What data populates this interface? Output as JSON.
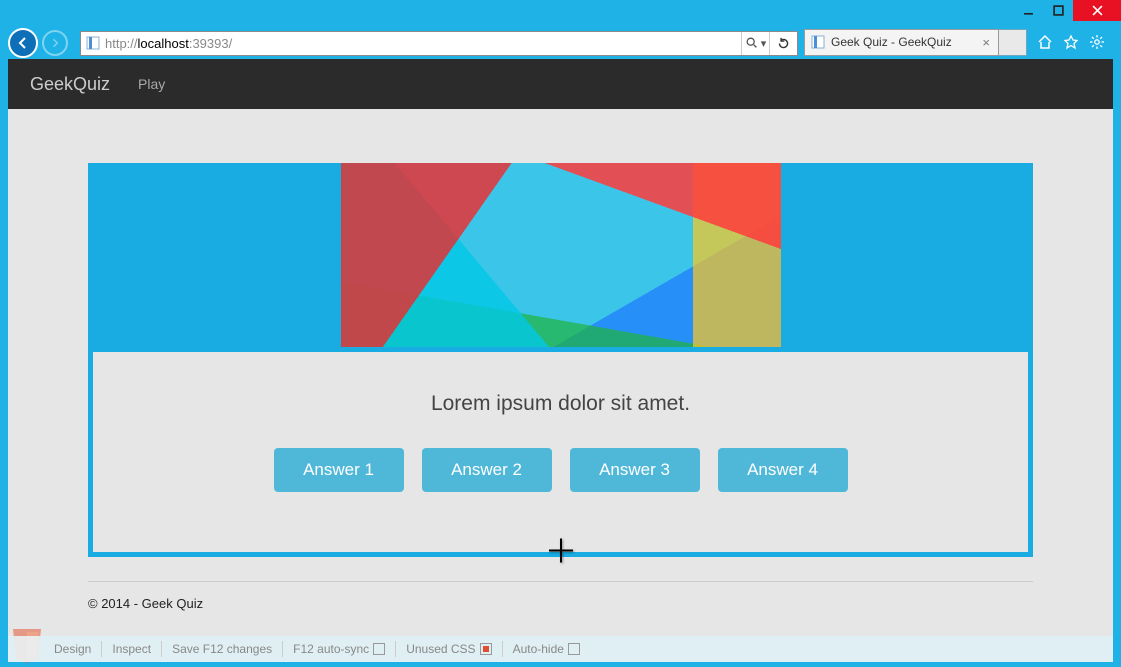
{
  "window": {
    "url_prefix": "http://",
    "url_host": "localhost",
    "url_port": ":39393/",
    "tab_title": "Geek Quiz - GeekQuiz"
  },
  "site": {
    "brand": "GeekQuiz",
    "nav_play": "Play"
  },
  "quiz": {
    "question": "Lorem ipsum dolor sit amet.",
    "answers": [
      "Answer 1",
      "Answer 2",
      "Answer 3",
      "Answer 4"
    ]
  },
  "footer": {
    "copyright": "© 2014 - Geek Quiz"
  },
  "browserlink": {
    "design": "Design",
    "inspect": "Inspect",
    "save_f12": "Save F12 changes",
    "autosync": "F12 auto-sync",
    "unused_css": "Unused CSS",
    "autohide": "Auto-hide"
  }
}
